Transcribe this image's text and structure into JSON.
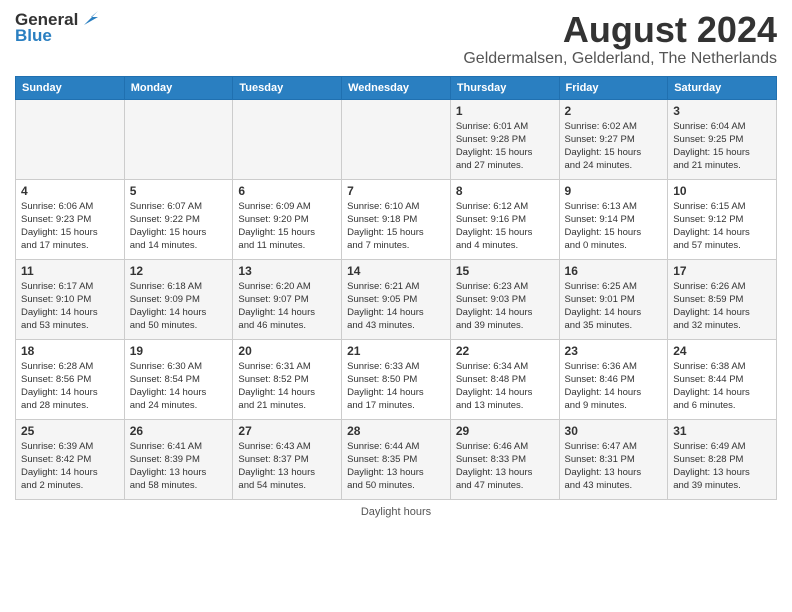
{
  "header": {
    "logo_general": "General",
    "logo_blue": "Blue",
    "main_title": "August 2024",
    "subtitle": "Geldermalsen, Gelderland, The Netherlands"
  },
  "calendar": {
    "days_of_week": [
      "Sunday",
      "Monday",
      "Tuesday",
      "Wednesday",
      "Thursday",
      "Friday",
      "Saturday"
    ],
    "weeks": [
      [
        {
          "day": "",
          "info": ""
        },
        {
          "day": "",
          "info": ""
        },
        {
          "day": "",
          "info": ""
        },
        {
          "day": "",
          "info": ""
        },
        {
          "day": "1",
          "info": "Sunrise: 6:01 AM\nSunset: 9:28 PM\nDaylight: 15 hours\nand 27 minutes."
        },
        {
          "day": "2",
          "info": "Sunrise: 6:02 AM\nSunset: 9:27 PM\nDaylight: 15 hours\nand 24 minutes."
        },
        {
          "day": "3",
          "info": "Sunrise: 6:04 AM\nSunset: 9:25 PM\nDaylight: 15 hours\nand 21 minutes."
        }
      ],
      [
        {
          "day": "4",
          "info": "Sunrise: 6:06 AM\nSunset: 9:23 PM\nDaylight: 15 hours\nand 17 minutes."
        },
        {
          "day": "5",
          "info": "Sunrise: 6:07 AM\nSunset: 9:22 PM\nDaylight: 15 hours\nand 14 minutes."
        },
        {
          "day": "6",
          "info": "Sunrise: 6:09 AM\nSunset: 9:20 PM\nDaylight: 15 hours\nand 11 minutes."
        },
        {
          "day": "7",
          "info": "Sunrise: 6:10 AM\nSunset: 9:18 PM\nDaylight: 15 hours\nand 7 minutes."
        },
        {
          "day": "8",
          "info": "Sunrise: 6:12 AM\nSunset: 9:16 PM\nDaylight: 15 hours\nand 4 minutes."
        },
        {
          "day": "9",
          "info": "Sunrise: 6:13 AM\nSunset: 9:14 PM\nDaylight: 15 hours\nand 0 minutes."
        },
        {
          "day": "10",
          "info": "Sunrise: 6:15 AM\nSunset: 9:12 PM\nDaylight: 14 hours\nand 57 minutes."
        }
      ],
      [
        {
          "day": "11",
          "info": "Sunrise: 6:17 AM\nSunset: 9:10 PM\nDaylight: 14 hours\nand 53 minutes."
        },
        {
          "day": "12",
          "info": "Sunrise: 6:18 AM\nSunset: 9:09 PM\nDaylight: 14 hours\nand 50 minutes."
        },
        {
          "day": "13",
          "info": "Sunrise: 6:20 AM\nSunset: 9:07 PM\nDaylight: 14 hours\nand 46 minutes."
        },
        {
          "day": "14",
          "info": "Sunrise: 6:21 AM\nSunset: 9:05 PM\nDaylight: 14 hours\nand 43 minutes."
        },
        {
          "day": "15",
          "info": "Sunrise: 6:23 AM\nSunset: 9:03 PM\nDaylight: 14 hours\nand 39 minutes."
        },
        {
          "day": "16",
          "info": "Sunrise: 6:25 AM\nSunset: 9:01 PM\nDaylight: 14 hours\nand 35 minutes."
        },
        {
          "day": "17",
          "info": "Sunrise: 6:26 AM\nSunset: 8:59 PM\nDaylight: 14 hours\nand 32 minutes."
        }
      ],
      [
        {
          "day": "18",
          "info": "Sunrise: 6:28 AM\nSunset: 8:56 PM\nDaylight: 14 hours\nand 28 minutes."
        },
        {
          "day": "19",
          "info": "Sunrise: 6:30 AM\nSunset: 8:54 PM\nDaylight: 14 hours\nand 24 minutes."
        },
        {
          "day": "20",
          "info": "Sunrise: 6:31 AM\nSunset: 8:52 PM\nDaylight: 14 hours\nand 21 minutes."
        },
        {
          "day": "21",
          "info": "Sunrise: 6:33 AM\nSunset: 8:50 PM\nDaylight: 14 hours\nand 17 minutes."
        },
        {
          "day": "22",
          "info": "Sunrise: 6:34 AM\nSunset: 8:48 PM\nDaylight: 14 hours\nand 13 minutes."
        },
        {
          "day": "23",
          "info": "Sunrise: 6:36 AM\nSunset: 8:46 PM\nDaylight: 14 hours\nand 9 minutes."
        },
        {
          "day": "24",
          "info": "Sunrise: 6:38 AM\nSunset: 8:44 PM\nDaylight: 14 hours\nand 6 minutes."
        }
      ],
      [
        {
          "day": "25",
          "info": "Sunrise: 6:39 AM\nSunset: 8:42 PM\nDaylight: 14 hours\nand 2 minutes."
        },
        {
          "day": "26",
          "info": "Sunrise: 6:41 AM\nSunset: 8:39 PM\nDaylight: 13 hours\nand 58 minutes."
        },
        {
          "day": "27",
          "info": "Sunrise: 6:43 AM\nSunset: 8:37 PM\nDaylight: 13 hours\nand 54 minutes."
        },
        {
          "day": "28",
          "info": "Sunrise: 6:44 AM\nSunset: 8:35 PM\nDaylight: 13 hours\nand 50 minutes."
        },
        {
          "day": "29",
          "info": "Sunrise: 6:46 AM\nSunset: 8:33 PM\nDaylight: 13 hours\nand 47 minutes."
        },
        {
          "day": "30",
          "info": "Sunrise: 6:47 AM\nSunset: 8:31 PM\nDaylight: 13 hours\nand 43 minutes."
        },
        {
          "day": "31",
          "info": "Sunrise: 6:49 AM\nSunset: 8:28 PM\nDaylight: 13 hours\nand 39 minutes."
        }
      ]
    ]
  },
  "footer": {
    "text": "Daylight hours"
  }
}
